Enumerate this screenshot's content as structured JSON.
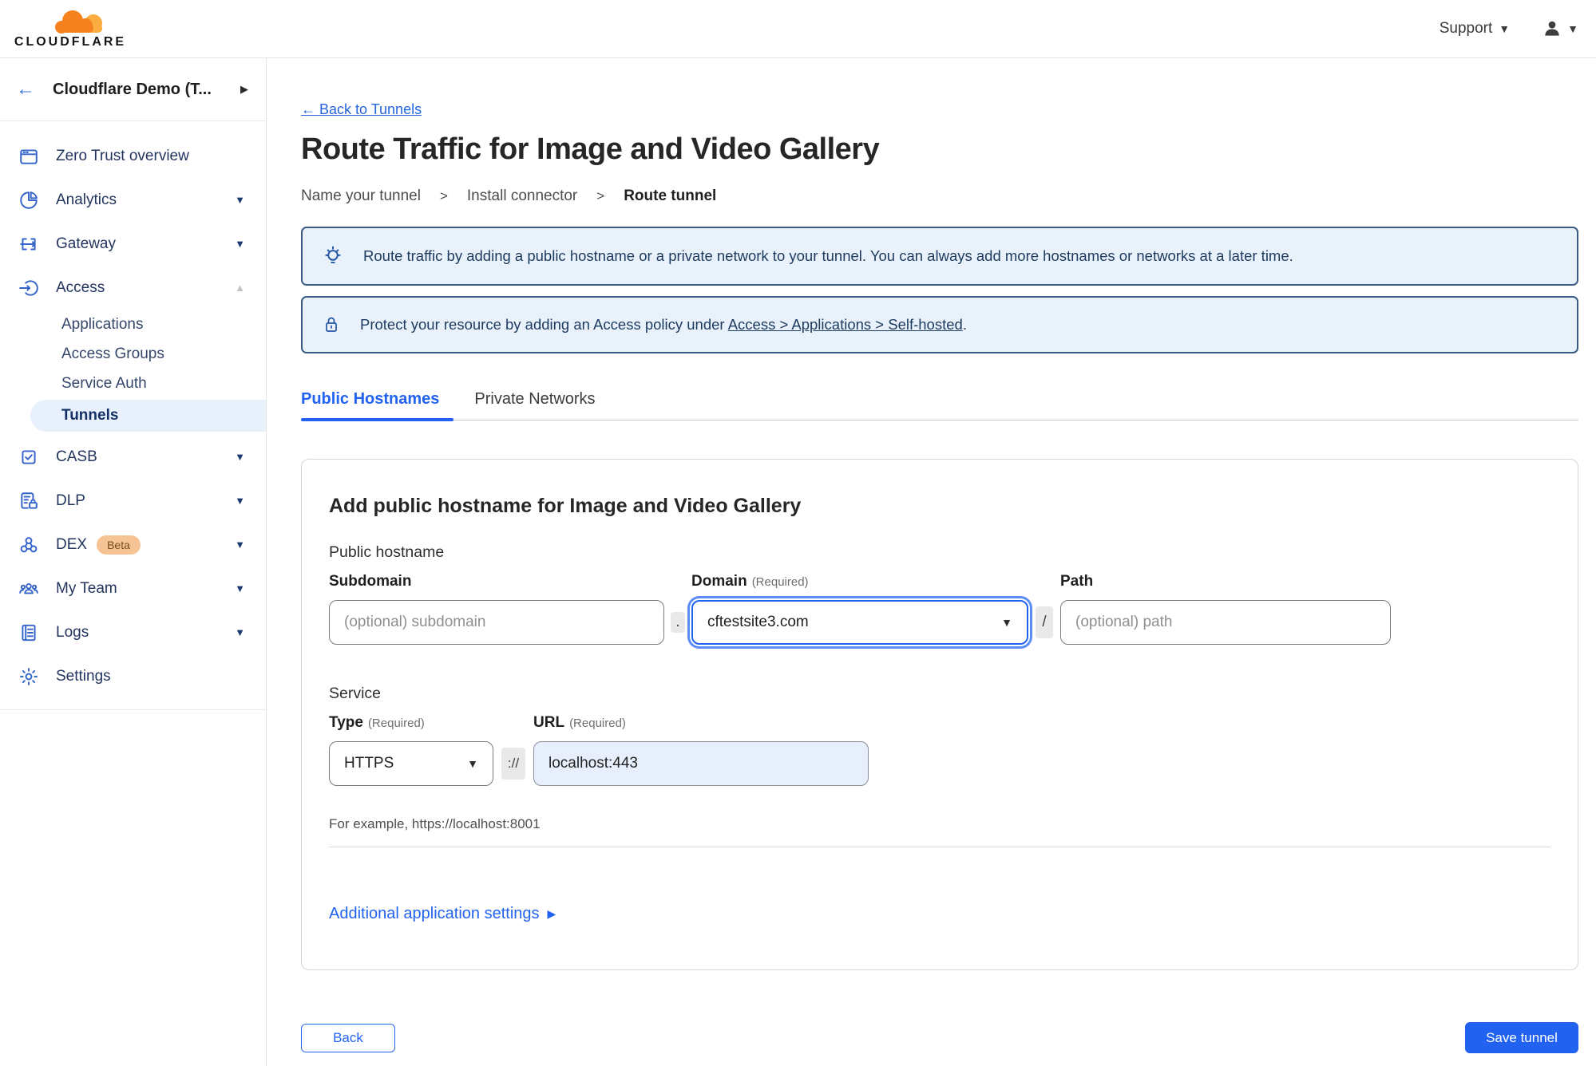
{
  "header": {
    "brand": "CLOUDFLARE",
    "support_label": "Support"
  },
  "sidebar": {
    "account_label": "Cloudflare Demo (T...",
    "items": [
      {
        "label": "Zero Trust overview",
        "icon": "window-icon"
      },
      {
        "label": "Analytics",
        "icon": "pie-chart-icon"
      },
      {
        "label": "Gateway",
        "icon": "gateway-icon"
      },
      {
        "label": "Access",
        "icon": "access-icon",
        "expanded": true
      },
      {
        "label": "CASB",
        "icon": "casb-icon"
      },
      {
        "label": "DLP",
        "icon": "dlp-icon"
      },
      {
        "label": "DEX",
        "icon": "dex-icon",
        "badge": "Beta"
      },
      {
        "label": "My Team",
        "icon": "team-icon"
      },
      {
        "label": "Logs",
        "icon": "logs-icon"
      },
      {
        "label": "Settings",
        "icon": "gear-icon"
      }
    ],
    "access_sub_items": [
      {
        "label": "Applications"
      },
      {
        "label": "Access Groups"
      },
      {
        "label": "Service Auth"
      },
      {
        "label": "Tunnels",
        "active": true
      }
    ]
  },
  "page": {
    "back_link": "← Back to Tunnels",
    "title": "Route Traffic for Image and Video Gallery",
    "steps": [
      "Name your tunnel",
      "Install connector",
      "Route tunnel"
    ],
    "step_separator": ">"
  },
  "banners": [
    {
      "icon": "lightbulb-icon",
      "text": "Route traffic by adding a public hostname or a private network to your tunnel. You can always add more hostnames or networks at a later time."
    },
    {
      "icon": "lock-icon",
      "text_before": "Protect your resource by adding an Access policy under ",
      "link": "Access > Applications > Self-hosted",
      "text_after": "."
    }
  ],
  "tabs": [
    {
      "label": "Public Hostnames",
      "active": true
    },
    {
      "label": "Private Networks",
      "active": false
    }
  ],
  "form": {
    "heading": "Add public hostname for Image and Video Gallery",
    "public_hostname_label": "Public hostname",
    "subdomain": {
      "label": "Subdomain",
      "placeholder": "(optional) subdomain"
    },
    "domain": {
      "label": "Domain",
      "required": "(Required)",
      "value": "cftestsite3.com"
    },
    "path": {
      "label": "Path",
      "placeholder": "(optional) path"
    },
    "separators": {
      "dot": ".",
      "slash": "/",
      "scheme": "://"
    },
    "service_label": "Service",
    "type": {
      "label": "Type",
      "required": "(Required)",
      "value": "HTTPS"
    },
    "url": {
      "label": "URL",
      "required": "(Required)",
      "value": "localhost:443"
    },
    "example": "For example, https://localhost:8001",
    "additional_settings_label": "Additional application settings"
  },
  "footer": {
    "back_label": "Back",
    "save_label": "Save tunnel"
  },
  "colors": {
    "accent_blue": "#2262f1",
    "banner_bg": "#e9f1fb",
    "banner_border": "#3a5c84",
    "active_pill_bg": "#e7f0fb",
    "logo_orange": "#f6821f",
    "logo_light_orange": "#fbad41",
    "beta_badge_bg": "#f6c494",
    "url_field_bg": "#e7effc"
  }
}
